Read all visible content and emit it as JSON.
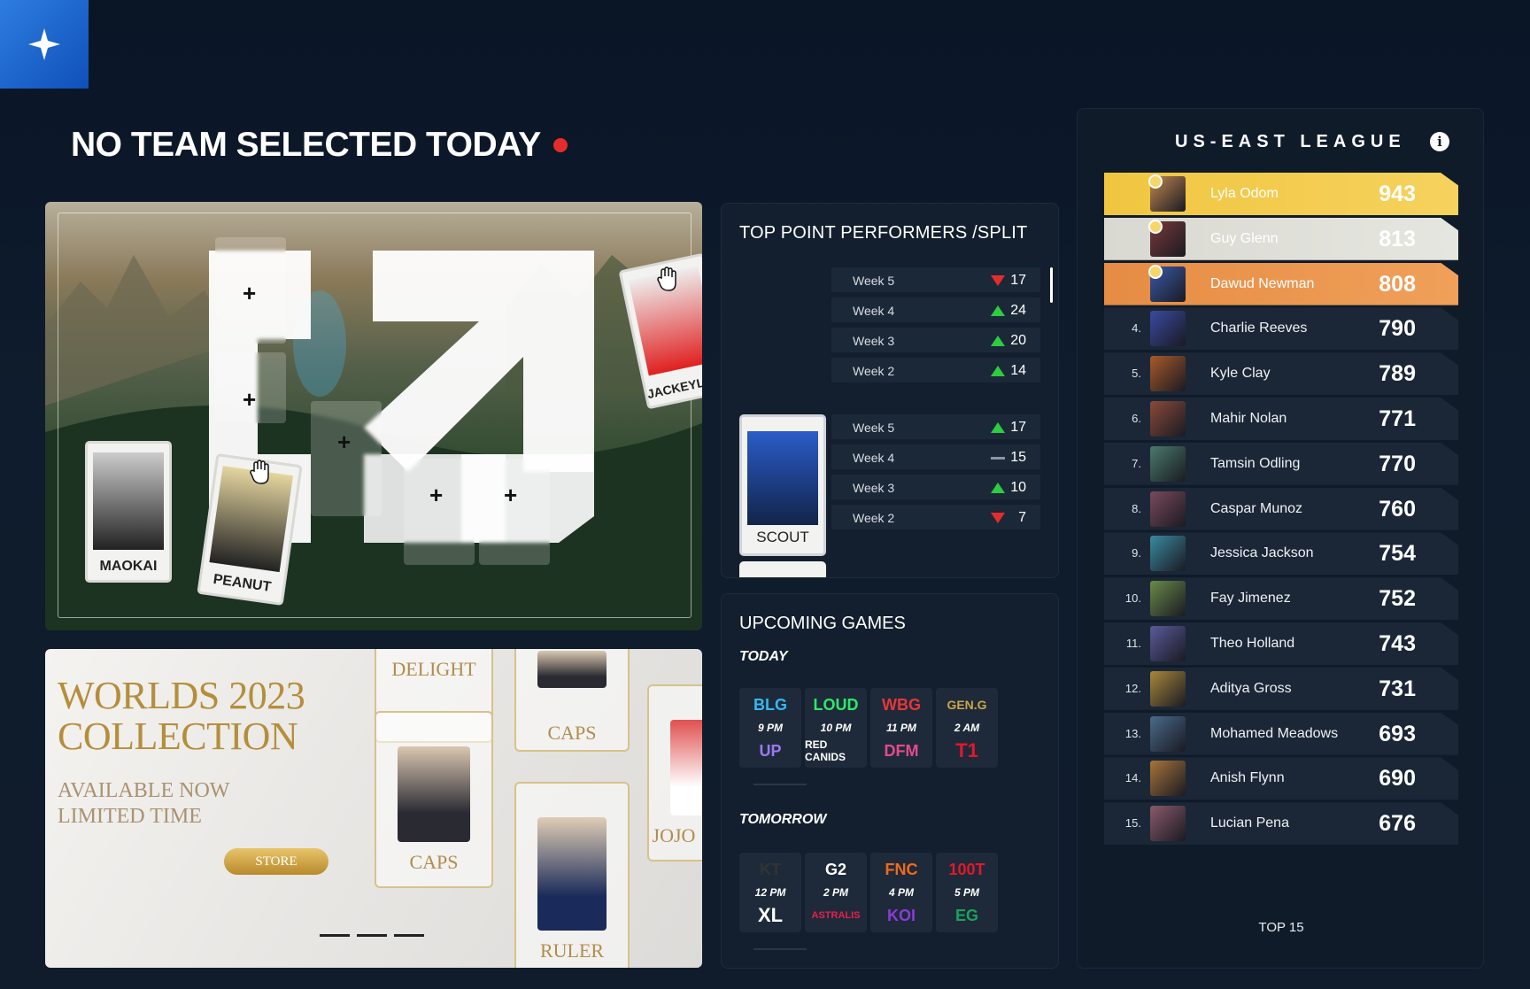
{
  "header": {
    "title": "NO TEAM SELECTED TODAY"
  },
  "hero": {
    "cards": [
      {
        "name": "MAOKAI"
      },
      {
        "name": "PEANUT"
      },
      {
        "name": "JACKEYLOVE"
      }
    ]
  },
  "performers": {
    "title": "TOP POINT PERFORMERS /SPLIT",
    "players": [
      {
        "name": "",
        "weeks": [
          {
            "week": "Week 5",
            "trend": "down",
            "value": "17"
          },
          {
            "week": "Week 4",
            "trend": "up",
            "value": "24"
          },
          {
            "week": "Week 3",
            "trend": "up",
            "value": "20"
          },
          {
            "week": "Week 2",
            "trend": "up",
            "value": "14"
          }
        ]
      },
      {
        "name": "SCOUT",
        "weeks": [
          {
            "week": "Week 5",
            "trend": "up",
            "value": "17"
          },
          {
            "week": "Week 4",
            "trend": "flat",
            "value": "15"
          },
          {
            "week": "Week 3",
            "trend": "up",
            "value": "10"
          },
          {
            "week": "Week 2",
            "trend": "down",
            "value": "7"
          }
        ]
      }
    ]
  },
  "upcoming": {
    "title": "UPCOMING GAMES",
    "today_label": "TODAY",
    "tomorrow_label": "TOMORROW",
    "today": [
      {
        "time": "9 PM",
        "team1": "BLG",
        "team2": "UP"
      },
      {
        "time": "10 PM",
        "team1": "LOUD",
        "team2": "RED CANIDS"
      },
      {
        "time": "11 PM",
        "team1": "WBG",
        "team2": "DFM"
      },
      {
        "time": "2 AM",
        "team1": "GEN.G",
        "team2": "T1"
      }
    ],
    "tomorrow": [
      {
        "time": "12 PM",
        "team1": "KT",
        "team2": "XL"
      },
      {
        "time": "2 PM",
        "team1": "G2",
        "team2": "ASTRALIS"
      },
      {
        "time": "4 PM",
        "team1": "FNC",
        "team2": "KOI"
      },
      {
        "time": "5 PM",
        "team1": "100T",
        "team2": "EG"
      }
    ]
  },
  "worlds": {
    "title_line1": "WORLDS 2023",
    "title_line2": "COLLECTION",
    "subtitle_line1": "AVAILABLE NOW",
    "subtitle_line2": "LIMITED TIME",
    "store_label": "STORE",
    "cards": [
      "DELIGHT",
      "CAPS",
      "CAPS",
      "RULER",
      "JOJO"
    ]
  },
  "league": {
    "title": "US-EAST LEAGUE",
    "footer": "TOP 15",
    "rows": [
      {
        "rank": "",
        "name": "Lyla Odom",
        "points": "943",
        "tier": "gold"
      },
      {
        "rank": "",
        "name": "Guy Glenn",
        "points": "813",
        "tier": "silver"
      },
      {
        "rank": "",
        "name": "Dawud Newman",
        "points": "808",
        "tier": "bronze"
      },
      {
        "rank": "4.",
        "name": "Charlie Reeves",
        "points": "790",
        "tier": ""
      },
      {
        "rank": "5.",
        "name": "Kyle Clay",
        "points": "789",
        "tier": ""
      },
      {
        "rank": "6.",
        "name": "Mahir Nolan",
        "points": "771",
        "tier": ""
      },
      {
        "rank": "7.",
        "name": "Tamsin Odling",
        "points": "770",
        "tier": ""
      },
      {
        "rank": "8.",
        "name": "Caspar Munoz",
        "points": "760",
        "tier": ""
      },
      {
        "rank": "9.",
        "name": "Jessica Jackson",
        "points": "754",
        "tier": ""
      },
      {
        "rank": "10.",
        "name": "Fay Jimenez",
        "points": "752",
        "tier": ""
      },
      {
        "rank": "11.",
        "name": "Theo Holland",
        "points": "743",
        "tier": ""
      },
      {
        "rank": "12.",
        "name": "Aditya Gross",
        "points": "731",
        "tier": ""
      },
      {
        "rank": "13.",
        "name": "Mohamed Meadows",
        "points": "693",
        "tier": ""
      },
      {
        "rank": "14.",
        "name": "Anish Flynn",
        "points": "690",
        "tier": ""
      },
      {
        "rank": "15.",
        "name": "Lucian Pena",
        "points": "676",
        "tier": ""
      }
    ]
  },
  "colors": {
    "accent": "#2d7de0",
    "alert": "#e52c2c",
    "up": "#2ecc40",
    "down": "#e52c2c",
    "gold": "#f0c640",
    "silver": "#d9d9d2",
    "bronze": "#e68c44"
  }
}
